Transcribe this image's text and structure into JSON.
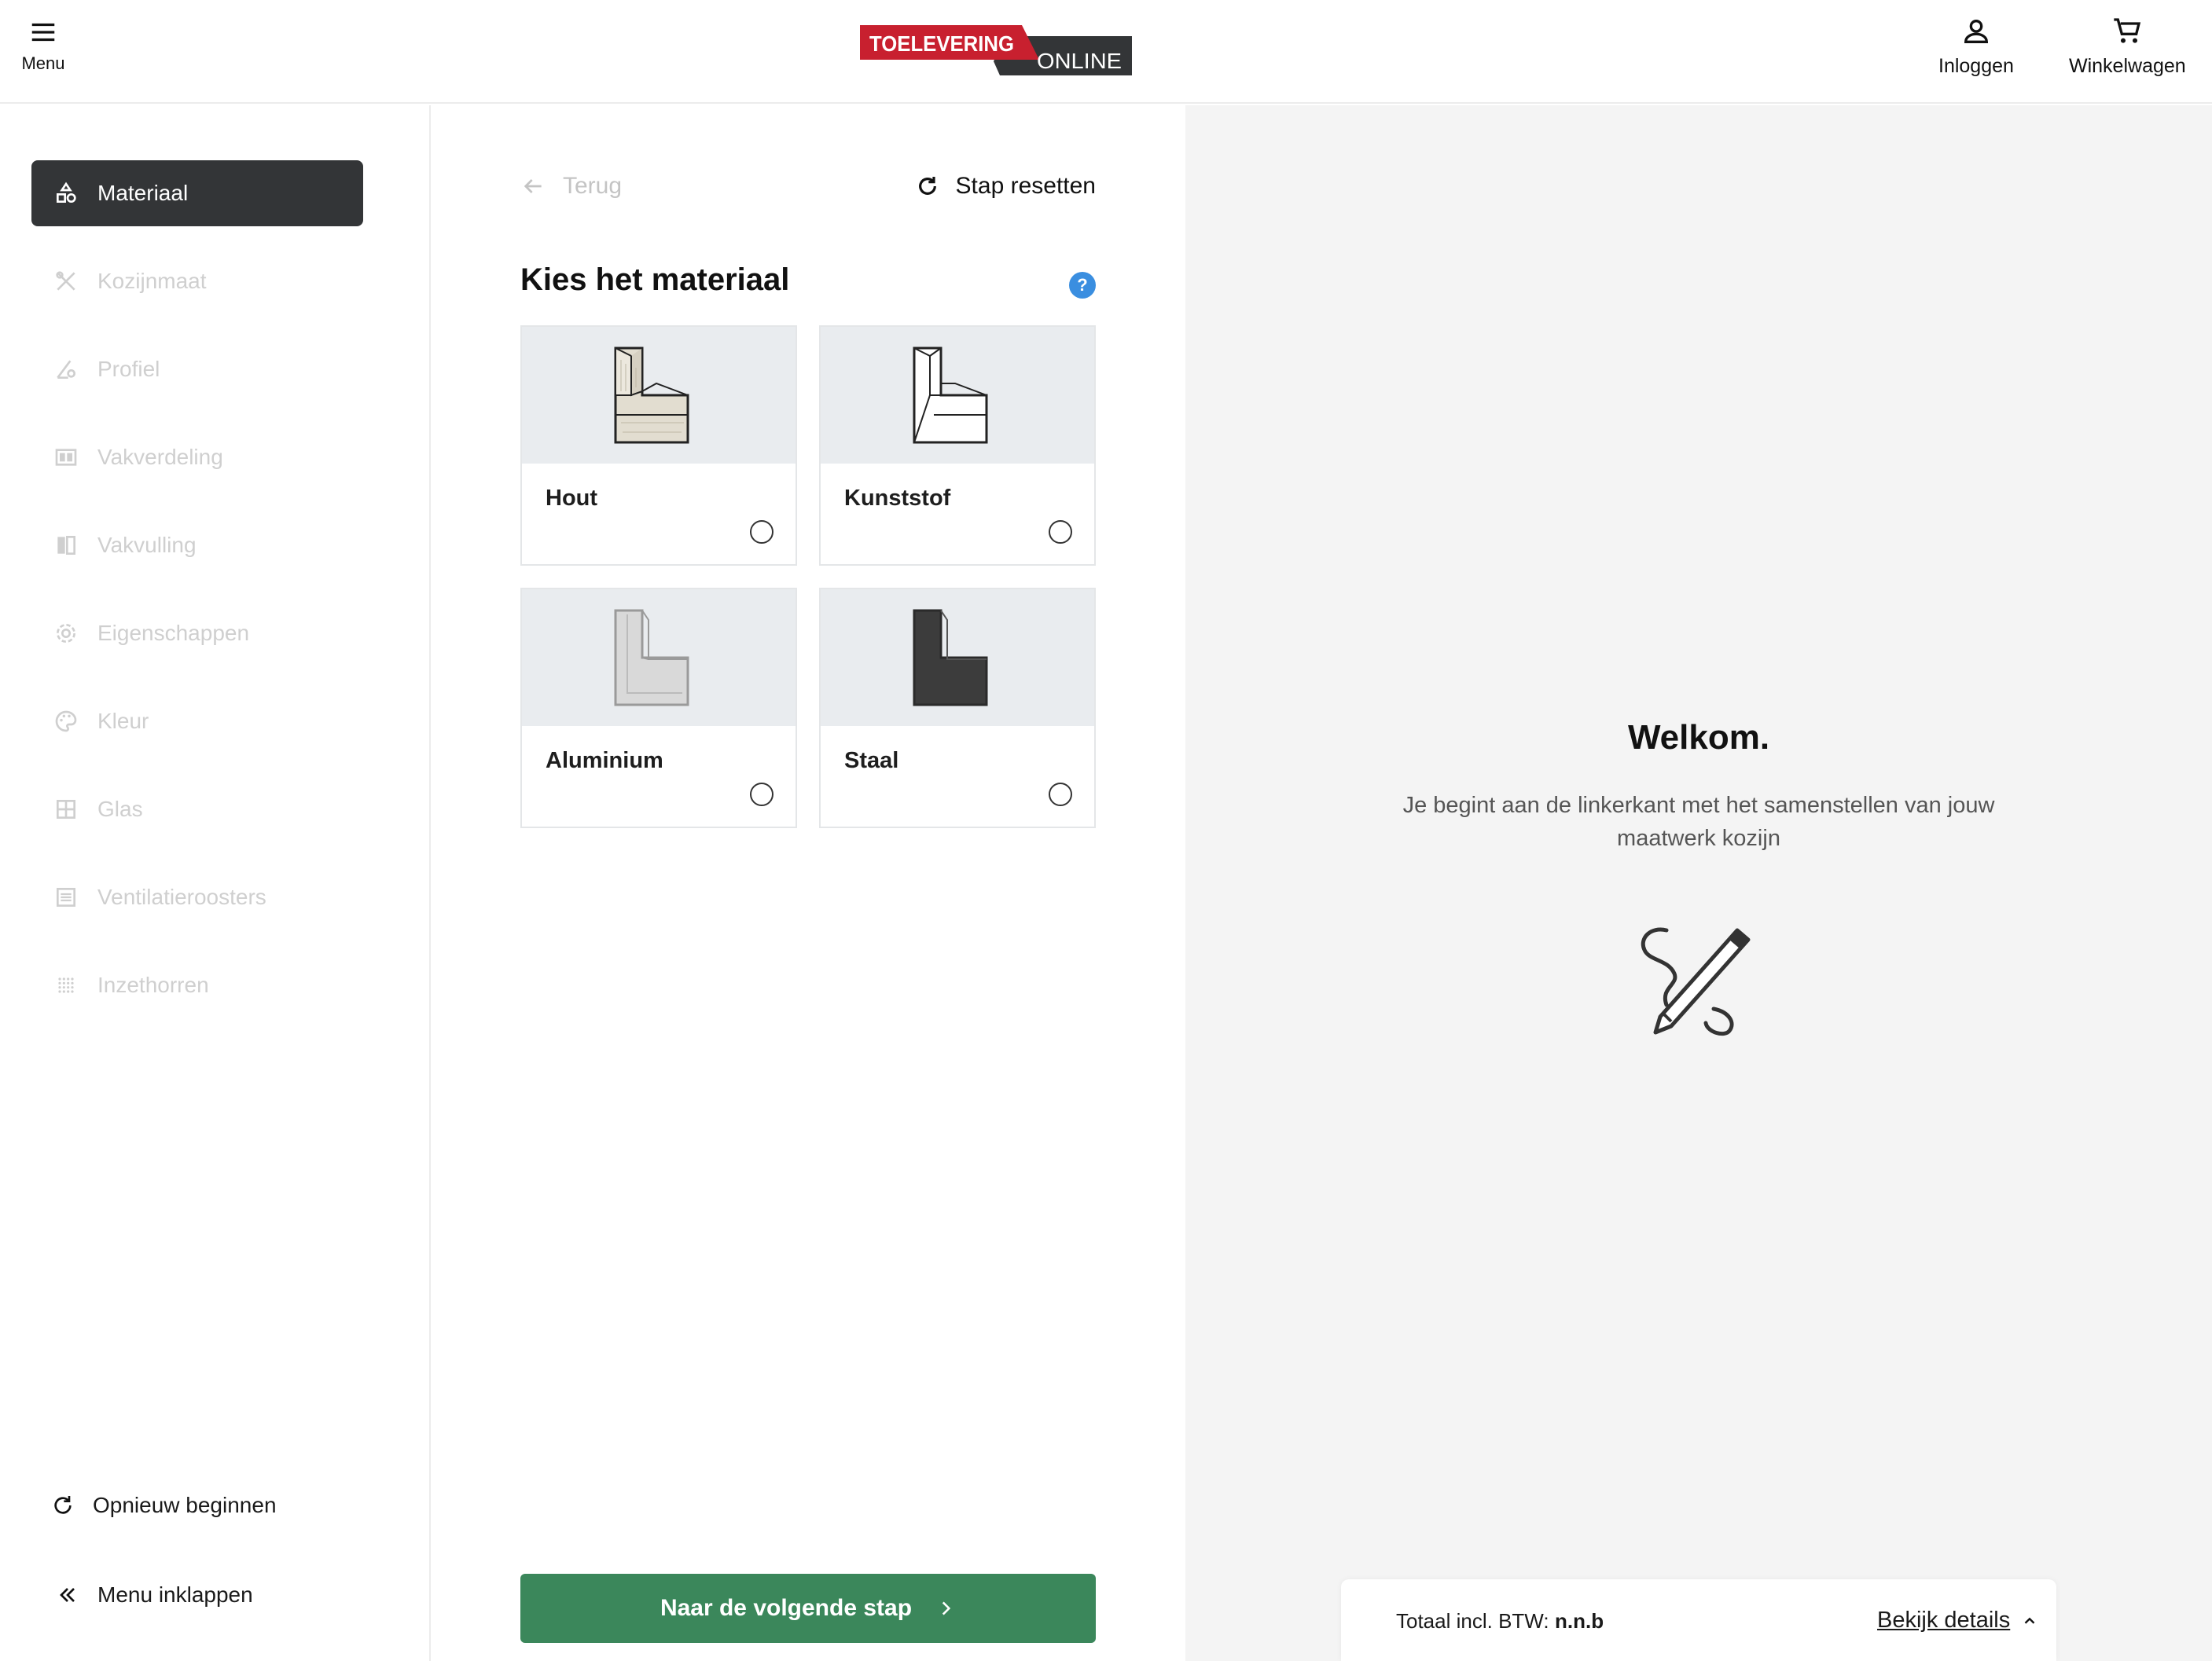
{
  "header": {
    "menu_label": "Menu",
    "logo_top": "TOELEVERING",
    "logo_bottom": "ONLINE",
    "login_label": "Inloggen",
    "cart_label": "Winkelwagen",
    "brand_red": "#c8202f",
    "brand_dark": "#333537"
  },
  "sidebar": {
    "steps": [
      {
        "label": "Materiaal",
        "icon": "shapes-icon",
        "active": true
      },
      {
        "label": "Kozijnmaat",
        "icon": "tools-icon",
        "active": false
      },
      {
        "label": "Profiel",
        "icon": "profile-icon",
        "active": false
      },
      {
        "label": "Vakverdeling",
        "icon": "division-icon",
        "active": false
      },
      {
        "label": "Vakvulling",
        "icon": "fill-icon",
        "active": false
      },
      {
        "label": "Eigenschappen",
        "icon": "gear-icon",
        "active": false
      },
      {
        "label": "Kleur",
        "icon": "palette-icon",
        "active": false
      },
      {
        "label": "Glas",
        "icon": "window-icon",
        "active": false
      },
      {
        "label": "Ventilatieroosters",
        "icon": "vent-icon",
        "active": false
      },
      {
        "label": "Inzethorren",
        "icon": "grid-dots-icon",
        "active": false
      }
    ],
    "restart_label": "Opnieuw beginnen",
    "collapse_label": "Menu inklappen"
  },
  "main": {
    "back_label": "Terug",
    "reset_label": "Stap resetten",
    "title": "Kies het materiaal",
    "help_label": "?",
    "options": [
      {
        "label": "Hout",
        "icon": "wood-profile-icon",
        "selected": false
      },
      {
        "label": "Kunststof",
        "icon": "plastic-profile-icon",
        "selected": false
      },
      {
        "label": "Aluminium",
        "icon": "aluminium-profile-icon",
        "selected": false
      },
      {
        "label": "Staal",
        "icon": "steel-profile-icon",
        "selected": false
      }
    ],
    "next_label": "Naar de volgende stap",
    "accent": "#3b875b"
  },
  "preview": {
    "welcome_title": "Welkom.",
    "welcome_text": "Je begint aan de linkerkant met het samenstellen van jouw maatwerk kozijn",
    "total_label": "Totaal incl. BTW:",
    "total_value": "n.n.b",
    "details_label": "Bekijk details"
  }
}
